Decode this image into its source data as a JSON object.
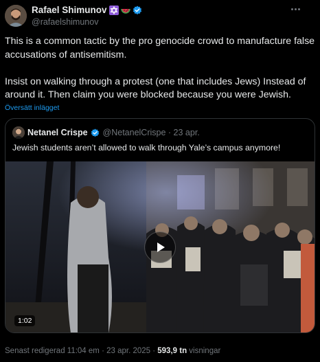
{
  "author": {
    "name": "Rafael Shimunov",
    "handle": "@rafaelshimunov",
    "emoji_icons": [
      "star-of-david-icon",
      "watermelon-icon",
      "verified-badge-icon"
    ]
  },
  "tweet": {
    "paragraphs": [
      "This is a common tactic by the pro genocide crowd to manufacture false accusations of antisemitism.",
      "Insist on walking through a protest (one that includes Jews) Instead of around it. Then claim you were blocked because you were Jewish."
    ],
    "translate_label": "Översätt inlägget"
  },
  "quote": {
    "author_name": "Netanel Crispe",
    "handle_date": "@NetanelCrispe · 23 apr.",
    "text": "Jewish students aren’t allowed to walk through Yale’s campus anymore!",
    "video_duration": "1:02"
  },
  "footer": {
    "edited": "Senast redigerad 11:04 em · 23 apr. 2025 · ",
    "views_count": "593,9 tn",
    "views_label": " visningar"
  },
  "colors": {
    "background": "#000000",
    "text": "#e7e9ea",
    "muted": "#71767b",
    "accent": "#1d9bf0",
    "border": "#2f3336"
  }
}
